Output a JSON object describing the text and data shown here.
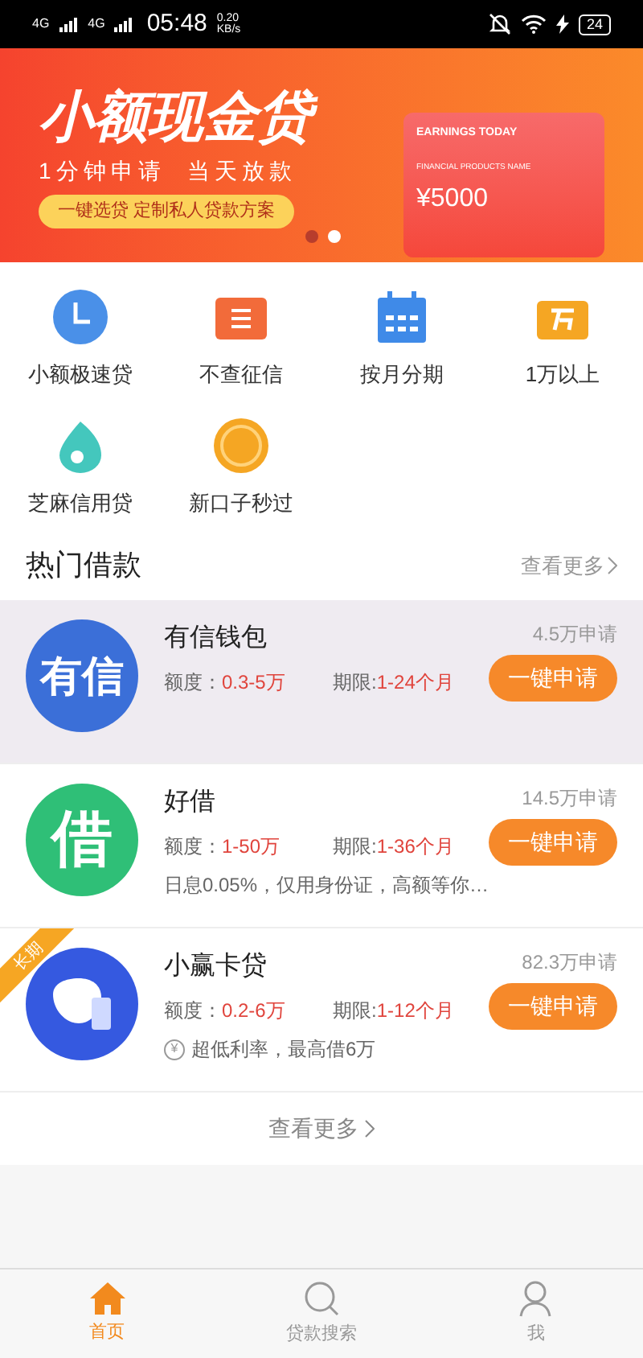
{
  "status_bar": {
    "network_1": "4G",
    "network_2": "4G",
    "time": "05:48",
    "speed": "0.20",
    "speed_unit": "KB/s",
    "battery": "24"
  },
  "banner": {
    "title": "小额现金贷",
    "subtitle": "1分钟申请  当天放款",
    "pill": "一键选贷 定制私人贷款方案",
    "card_heading": "EARNINGS TODAY",
    "card_label": "FINANCIAL PRODUCTS NAME",
    "card_amount": "¥5000",
    "dots": [
      {
        "selected": false
      },
      {
        "selected": true
      }
    ]
  },
  "categories": [
    {
      "label": "小额极速贷",
      "kind": "clock"
    },
    {
      "label": "不查征信",
      "kind": "xin"
    },
    {
      "label": "按月分期",
      "kind": "calendar"
    },
    {
      "label": "1万以上",
      "kind": "wan"
    },
    {
      "label": "芝麻信用贷",
      "kind": "drop"
    },
    {
      "label": "新口子秒过",
      "kind": "new"
    }
  ],
  "hot_section": {
    "title": "热门借款",
    "more": "查看更多"
  },
  "loans": [
    {
      "name": "有信钱包",
      "logo": "有信",
      "color": "#3b6fd8",
      "selected": true,
      "applicants": "4.5万申请",
      "limit_label": "额度：",
      "limit": "0.3-5万",
      "term_label": "期限:",
      "term": "1-24个月",
      "button": "一键申请"
    },
    {
      "name": "好借",
      "logo": "借",
      "color": "#2fbf77",
      "selected": false,
      "applicants": "14.5万申请",
      "limit_label": "额度：",
      "limit": "1-50万",
      "term_label": "期限:",
      "term": "1-36个月",
      "description": "日息0.05%，仅用身份证，高额等你…",
      "button": "一键申请"
    },
    {
      "name": "小赢卡贷",
      "color": "#3559e0",
      "selected": false,
      "ribbon": "长期",
      "applicants": "82.3万申请",
      "limit_label": "额度：",
      "limit": "0.2-6万",
      "term_label": "期限:",
      "term": "1-12个月",
      "description": "超低利率，最高借6万",
      "description_icon": "¥",
      "button": "一键申请"
    }
  ],
  "more_link": "查看更多",
  "tab_bar": [
    {
      "label": "首页",
      "kind": "home",
      "selected": true
    },
    {
      "label": "贷款搜索",
      "kind": "search",
      "selected": false
    },
    {
      "label": "我",
      "kind": "user",
      "selected": false
    }
  ]
}
